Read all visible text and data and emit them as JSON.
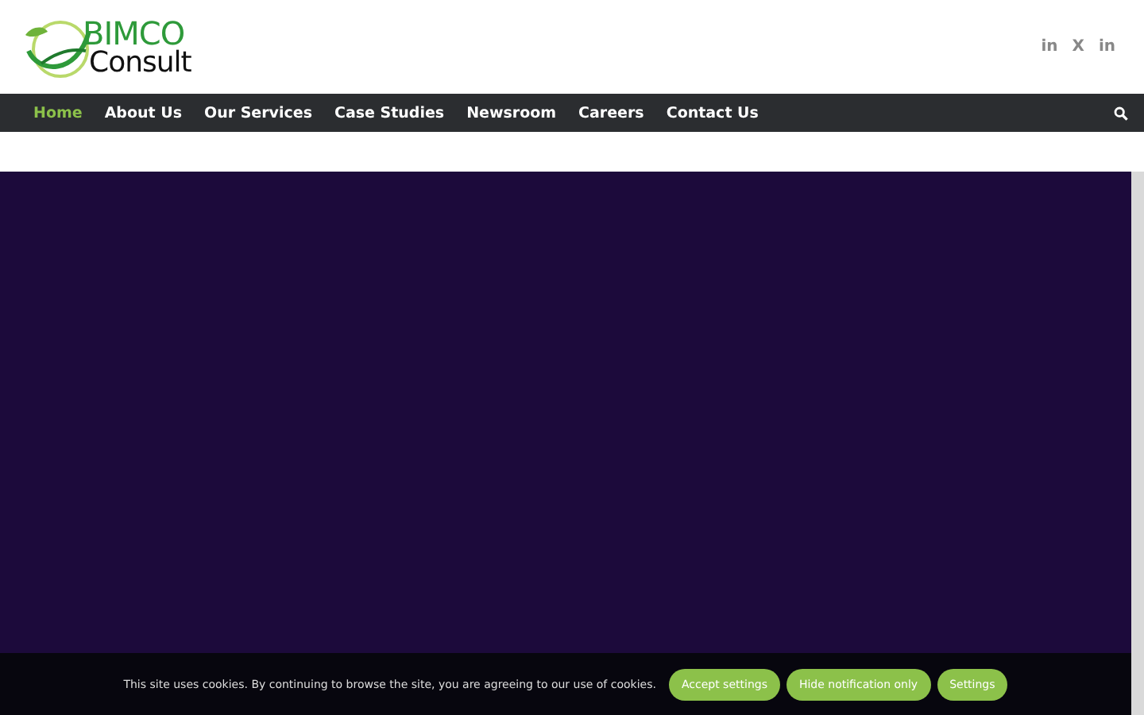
{
  "logo": {
    "line_1": "BIMCO",
    "line_2": "Consult"
  },
  "social": [
    "in",
    "X",
    "in"
  ],
  "nav": [
    {
      "label": "Home",
      "selected": true
    },
    {
      "label": "About Us",
      "selected": false
    },
    {
      "label": "Our Services",
      "selected": false
    },
    {
      "label": "Case Studies",
      "selected": false
    },
    {
      "label": "Newsroom",
      "selected": false
    },
    {
      "label": "Careers",
      "selected": false
    },
    {
      "label": "Contact Us",
      "selected": false
    }
  ],
  "cookie_bar": {
    "message": "This site uses cookies. By continuing to browse the site, you are agreeing to our use of cookies.",
    "buttons": [
      "Accept settings",
      "Hide notification only",
      "Settings"
    ]
  }
}
